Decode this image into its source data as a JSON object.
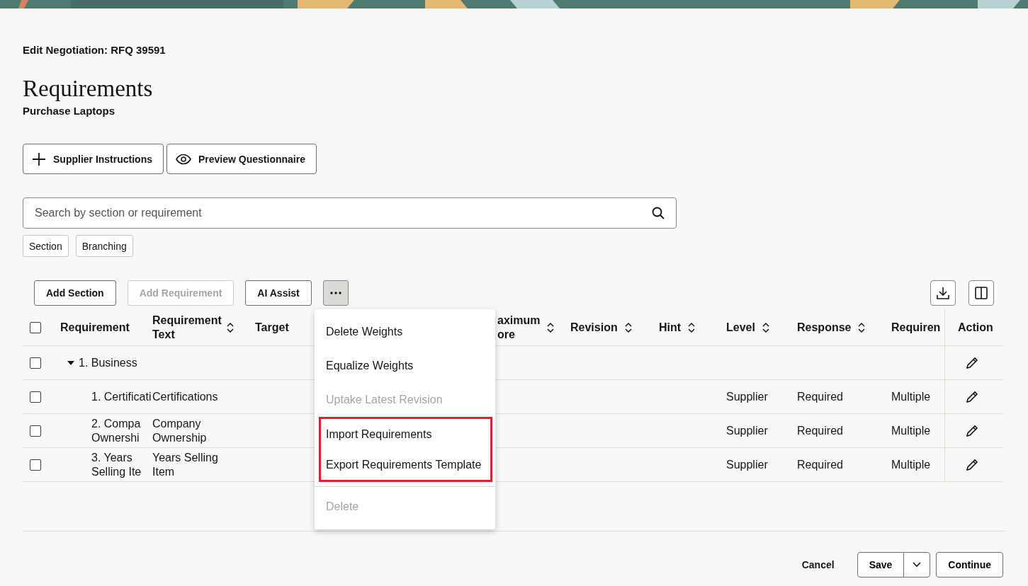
{
  "page": {
    "breadcrumb": "Edit Negotiation: RFQ 39591",
    "title": "Requirements",
    "subtitle": "Purchase Laptops"
  },
  "actions": [
    {
      "label": "Supplier Instructions",
      "kind": "add"
    },
    {
      "label": "Preview Questionnaire",
      "kind": "preview"
    }
  ],
  "search": {
    "placeholder": "Search by section or requirement"
  },
  "filters": [
    {
      "label": "Section"
    },
    {
      "label": "Branching"
    }
  ],
  "toolbar": [
    {
      "label": "Add Section",
      "disabled": false
    },
    {
      "label": "Add Requirement",
      "disabled": true
    },
    {
      "label": "AI Assist",
      "disabled": false
    }
  ],
  "table": {
    "all_checked": false,
    "columns": [
      {
        "label": "Requirement",
        "sortable": false
      },
      {
        "label": "Requirement Text",
        "sortable": true
      },
      {
        "label": "Target",
        "sortable": false
      },
      {
        "label": "aximum ore",
        "sortable": true
      },
      {
        "label": "Revision",
        "sortable": true
      },
      {
        "label": "Hint",
        "sortable": true
      },
      {
        "label": "Level",
        "sortable": true
      },
      {
        "label": "Response",
        "sortable": true
      },
      {
        "label": "Requiren",
        "sortable": false
      },
      {
        "label": "Action",
        "sortable": false
      }
    ],
    "rows": [
      {
        "kind": "section",
        "checked": false,
        "expanded": true,
        "requirement": "1. Business"
      },
      {
        "kind": "requirement",
        "checked": false,
        "requirement": "1. Certificati",
        "text": "Certifications",
        "level": "Supplier",
        "response": "Required",
        "column_9": "Multiple"
      },
      {
        "kind": "requirement",
        "checked": false,
        "requirement": "2. Compa Ownershi",
        "text": "Company Ownership",
        "level": "Supplier",
        "response": "Required",
        "column_9": "Multiple"
      },
      {
        "kind": "requirement",
        "checked": false,
        "requirement": "3. Years Selling Ite",
        "text": "Years Selling Item",
        "level": "Supplier",
        "response": "Required",
        "column_9": "Multiple"
      }
    ]
  },
  "menu": {
    "items": [
      {
        "label": "Delete Weights",
        "disabled": false,
        "highlighted": false
      },
      {
        "label": "Equalize Weights",
        "disabled": false,
        "highlighted": false
      },
      {
        "label": "Uptake Latest Revision",
        "disabled": true,
        "highlighted": false
      },
      {
        "label": "Import Requirements",
        "disabled": false,
        "highlighted": true
      },
      {
        "label": "Export Requirements Template",
        "disabled": false,
        "highlighted": true
      },
      {
        "label": "Delete",
        "disabled": true,
        "highlighted": false,
        "separated": true
      }
    ]
  },
  "footer": {
    "cancel": "Cancel",
    "save": "Save",
    "continue": "Continue"
  }
}
